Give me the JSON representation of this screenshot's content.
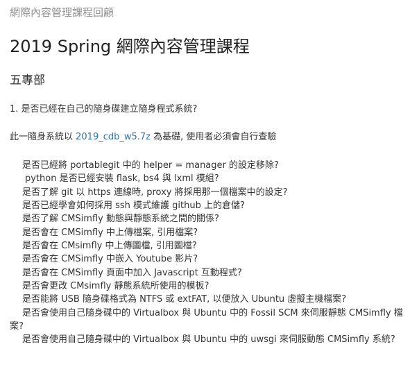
{
  "site_title": "網際內容管理課程回顧",
  "page_title": "2019 Spring 網際內容管理課程",
  "section_heading": "五專部",
  "question": "1. 是否已經在自己的隨身碟建立隨身程式系統?",
  "intro": {
    "prefix": "此一隨身系統以 ",
    "link_text": "2019_cdb_w5.7z",
    "suffix": " 為基礎, 使用者必須會自行查驗"
  },
  "checklist": [
    "是否已經將 portablegit 中的 helper = manager 的設定移除?",
    "python 是否已經安裝 flask, bs4 與 lxml 模組?",
    "是否了解 git 以 https 連線時, proxy 將採用那一個檔案中的設定?",
    "是否已經學會如何採用 ssh 模式維護 github 上的倉儲?",
    "是否了解 CMSimfly 動態與靜態系統之間的關係?",
    "是否會在 CMSimfly 中上傳檔案, 引用檔案?",
    "是否會在 CMsimfly 中上傳圖檔, 引用圖檔?",
    "是否會在 CMSimfly 中嵌入 Youtube 影片?",
    "是否會在 CMSimfly 頁面中加入 Javascript 互動程式?",
    "是否會更改 CMsimfly 靜態系統所使用的模板?",
    "是否能將 USB 隨身碟格式為 NTFS 或 extFAT, 以便放入 Ubuntu 虛擬主機檔案?",
    "是否會使用自己隨身碟中的 Virtualbox 與 Ubuntu 中的 Fossil SCM 來伺服靜態 CMSimfly 檔案?",
    "是否會使用自己隨身碟中的 Virtualbox 與 Ubuntu 中的 uwsgi 來伺服動態 CMSimfly 系統?"
  ],
  "colors": {
    "link": "#2f6fb8",
    "site_title": "#8f8f8f",
    "text": "#333333"
  }
}
